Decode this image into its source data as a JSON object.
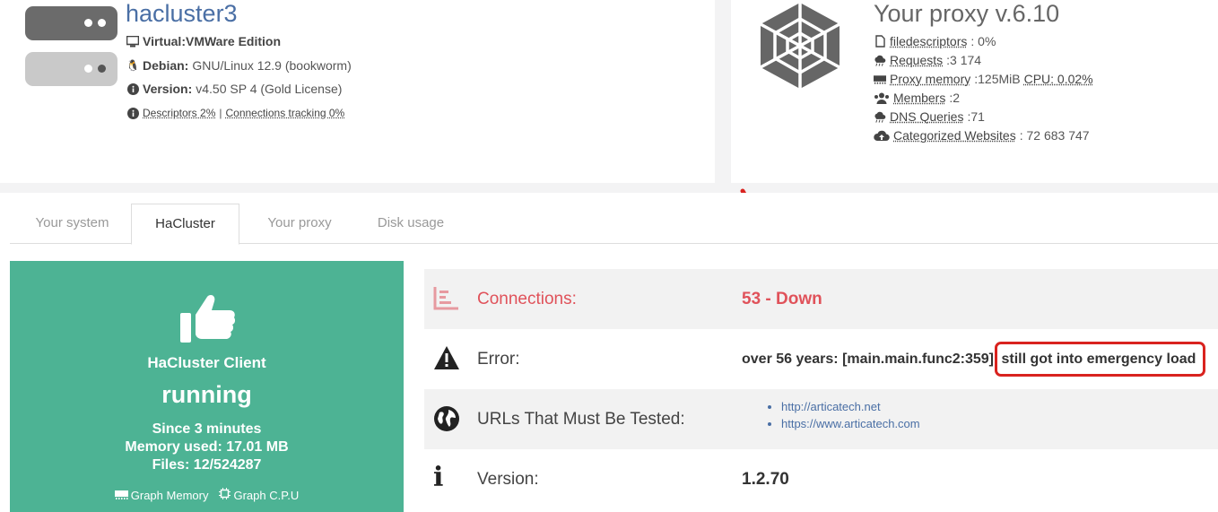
{
  "server": {
    "hostname": "hacluster3",
    "virtual_label": "Virtual:",
    "virtual_value": "VMWare Edition",
    "os_label": "Debian:",
    "os_value": "GNU/Linux 12.9 (bookworm)",
    "version_label": "Version:",
    "version_value": "v4.50 SP 4 (Gold License)",
    "descriptors_link": "Descriptors 2%",
    "separator": "|",
    "conntrack_link": "Connections tracking 0%",
    "icons": [
      "server-stack-icon",
      "monitor-icon",
      "linux-icon",
      "info-icon"
    ]
  },
  "proxy": {
    "title": "Your proxy v.6.10",
    "filedescriptors_label": "filedescriptors",
    "filedescriptors_value": ": 0%",
    "requests_label": "Requests",
    "requests_value": ":3 174",
    "memory_label": "Proxy memory",
    "memory_value": ":125MiB",
    "cpu_link": "CPU: 0.02%",
    "members_label": "Members",
    "members_value": ":2",
    "dns_label": "DNS Queries",
    "dns_value": ":71",
    "categorized_label": "Categorized Websites",
    "categorized_value": ": 72 683 747",
    "icons": [
      "spider-web-icon",
      "file-icon",
      "cloud-icon",
      "memory-icon",
      "users-icon",
      "cloud-icon",
      "cloud-upload-icon"
    ]
  },
  "tabs": [
    {
      "label": "Your system",
      "active": false
    },
    {
      "label": "HaCluster",
      "active": true
    },
    {
      "label": "Your proxy",
      "active": false
    },
    {
      "label": "Disk usage",
      "active": false
    }
  ],
  "client": {
    "name": "HaCluster Client",
    "status": "running",
    "since": "Since 3 minutes",
    "memory": "Memory used: 17.01 MB",
    "files": "Files: 12/524287",
    "graph_memory": "Graph Memory",
    "graph_cpu": "Graph C.P.U",
    "color": "#4db394",
    "icon": "thumbs-up-icon"
  },
  "details": {
    "connections_label": "Connections:",
    "connections_value": "53 - Down",
    "error_label": "Error:",
    "error_value_prefix": "over 56 years: [main.main.func2:359]",
    "error_value_highlight": "still got into emergency load",
    "urls_label": "URLs That Must Be Tested:",
    "urls": [
      "http://articatech.net",
      "https://www.articatech.com"
    ],
    "version_label": "Version:",
    "version_value": "1.2.70",
    "alert_color": "#e0525a",
    "annotation_color": "#d9231f"
  }
}
